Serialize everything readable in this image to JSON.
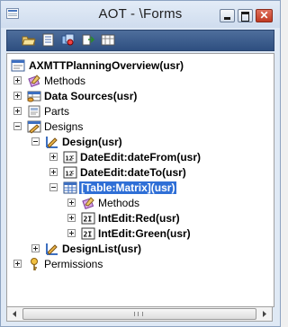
{
  "window": {
    "title": "AOT - \\Forms"
  },
  "titlebar_buttons": [
    "minimize",
    "maximize",
    "close"
  ],
  "toolbar": {
    "tools": [
      "open-icon",
      "properties-icon",
      "compile-icon",
      "import-icon",
      "filter-icon"
    ]
  },
  "tree": {
    "root": "AXMTTPlanningOverview(usr)",
    "methods": "Methods",
    "data_sources": "Data Sources(usr)",
    "parts": "Parts",
    "designs": "Designs",
    "design": "Design(usr)",
    "date_from": "DateEdit:dateFrom(usr)",
    "date_to": "DateEdit:dateTo(usr)",
    "table_matrix": "[Table:Matrix](usr)",
    "matrix_methods": "Methods",
    "int_red": "IntEdit:Red(usr)",
    "int_green": "IntEdit:Green(usr)",
    "design_list": "DesignList(usr)",
    "permissions": "Permissions"
  },
  "colors": {
    "selection": "#2f6fd6",
    "toolbar": "#3a5a8a",
    "title_bg": "#dfe9f5",
    "close": "#c94a34"
  }
}
